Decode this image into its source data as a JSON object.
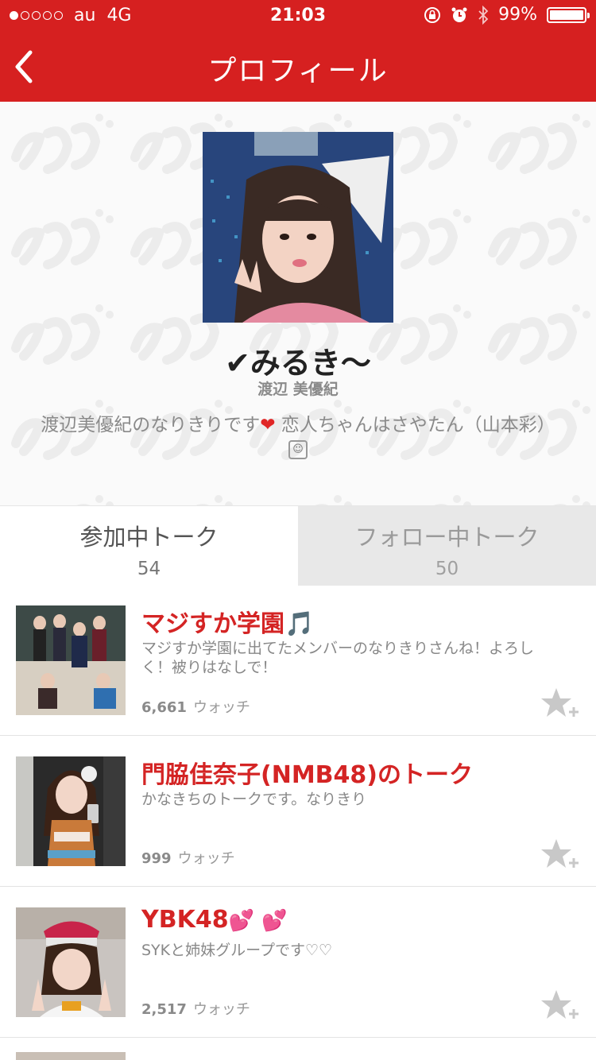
{
  "status_bar": {
    "carrier": "au",
    "network": "4G",
    "time": "21:03",
    "battery": "99%"
  },
  "nav": {
    "title": "プロフィール"
  },
  "profile": {
    "display_name": "✔みるき〜",
    "real_name": "渡辺 美優紀",
    "bio_part1": "渡辺美優紀のなりきりです",
    "bio_part2": " 恋人ちゃんはさやたん（山本彩）"
  },
  "tabs": [
    {
      "label": "参加中トーク",
      "count": "54",
      "active": true
    },
    {
      "label": "フォロー中トーク",
      "count": "50",
      "active": false
    }
  ],
  "talks": [
    {
      "title": "マジすか学園",
      "title_emoji": "🎵",
      "description": "マジすか学園に出てたメンバーのなりきりさんね！よろしく！被りはなしで！",
      "watch_count": "6,661",
      "watch_label": "ウォッチ"
    },
    {
      "title": "門脇佳奈子(NMB48)のトーク",
      "title_emoji": "",
      "description": "かなきちのトークです。なりきり",
      "watch_count": "999",
      "watch_label": "ウォッチ"
    },
    {
      "title": "YBK48",
      "title_emoji": "💕 💕",
      "description": "SYKと姉妹グループです♡♡",
      "watch_count": "2,517",
      "watch_label": "ウォッチ"
    }
  ],
  "colors": {
    "brand_red": "#d62020",
    "title_red": "#d42424",
    "inactive_tab": "#e8e8e8"
  }
}
